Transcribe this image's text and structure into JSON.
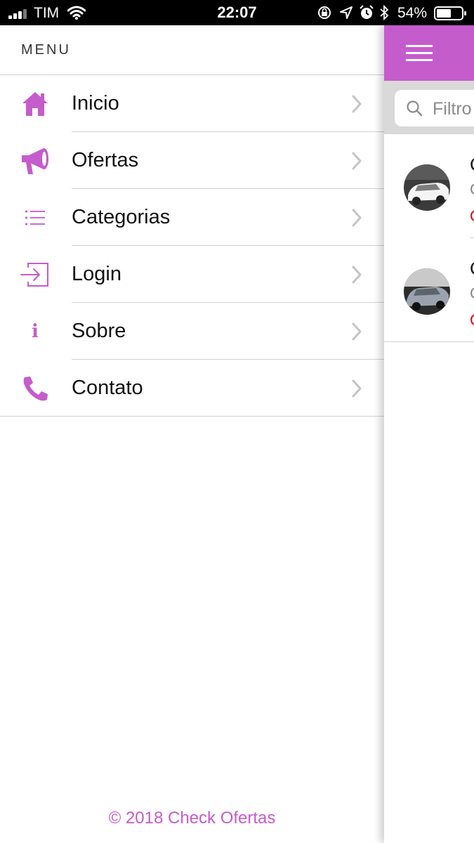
{
  "status_bar": {
    "carrier": "TIM",
    "time": "22:07",
    "battery": "54%",
    "icons": [
      "signal-icon",
      "wifi-icon",
      "rotation-lock-icon",
      "location-icon",
      "alarm-icon",
      "bluetooth-icon",
      "battery-icon"
    ]
  },
  "menu": {
    "title": "MENU",
    "items": [
      {
        "label": "Inicio",
        "icon": "home-icon"
      },
      {
        "label": "Ofertas",
        "icon": "megaphone-icon"
      },
      {
        "label": "Categorias",
        "icon": "list-icon"
      },
      {
        "label": "Login",
        "icon": "login-icon"
      },
      {
        "label": "Sobre",
        "icon": "info-icon"
      },
      {
        "label": "Contato",
        "icon": "phone-icon"
      }
    ],
    "footer": "© 2018 Check Ofertas"
  },
  "main": {
    "search": {
      "placeholder": "Filtro"
    },
    "list": [
      {
        "title": "C",
        "subtitle": "C",
        "price": "C"
      },
      {
        "title": "C",
        "subtitle": "C",
        "price": "C"
      }
    ]
  },
  "colors": {
    "accent": "#c55ccc",
    "price": "#e0001b",
    "divider": "#d0d0d0",
    "search_bg": "#d9d9d9"
  }
}
